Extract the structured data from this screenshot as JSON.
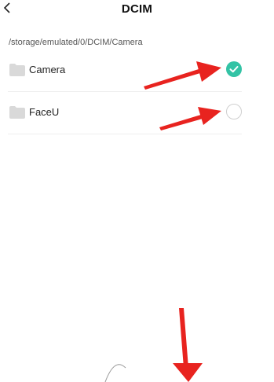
{
  "header": {
    "back_icon": "chevron-left-icon",
    "title": "DCIM"
  },
  "path": "/storage/emulated/0/DCIM/Camera",
  "folders": [
    {
      "name": "Camera",
      "icon": "folder-icon",
      "selected": true
    },
    {
      "name": "FaceU",
      "icon": "folder-icon",
      "selected": false
    }
  ],
  "colors": {
    "accent": "#33c3a5",
    "annotation_arrow": "#e8231f",
    "folder": "#d9d9d9"
  }
}
